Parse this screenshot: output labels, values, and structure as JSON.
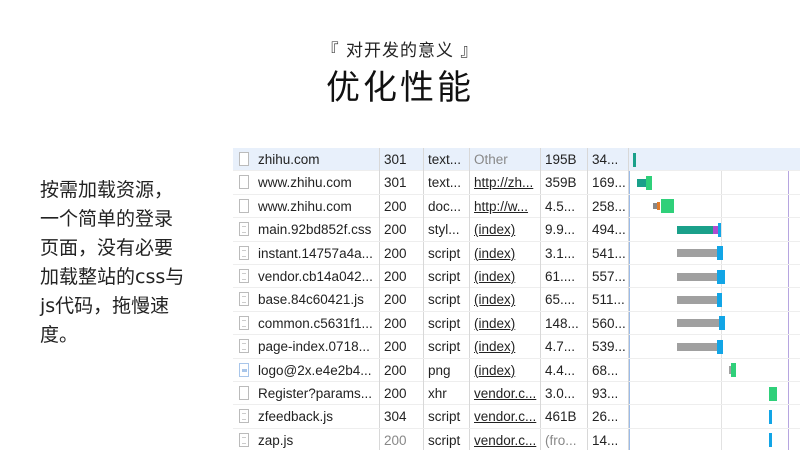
{
  "slide": {
    "subtitle": "『 对开发的意义 』",
    "title": "优化性能",
    "note_lines": [
      "按需加载资源，",
      "一个简单的登录",
      "页面，没有必要",
      "加载整站的css与",
      "js代码，拖慢速",
      "度。"
    ]
  },
  "colors": {
    "waiting": "#a0a0a0",
    "download": "#12a5e6",
    "teal": "#1aa08a",
    "green": "#2fd07a",
    "initial": "#888888"
  },
  "network": {
    "rows": [
      {
        "name": "zhihu.com",
        "status": "301",
        "type": "text...",
        "initiator": "Other",
        "size": "195B",
        "time": "34...",
        "icon": "document-icon"
      },
      {
        "name": "www.zhihu.com",
        "status": "301",
        "type": "text...",
        "initiator": "http://zh...",
        "size": "359B",
        "time": "169...",
        "icon": "document-icon"
      },
      {
        "name": "www.zhihu.com",
        "status": "200",
        "type": "doc...",
        "initiator": "http://w...",
        "size": "4.5...",
        "time": "258...",
        "icon": "document-icon"
      },
      {
        "name": "main.92bd852f.css",
        "status": "200",
        "type": "styl...",
        "initiator": "(index)",
        "size": "9.9...",
        "time": "494...",
        "icon": "stylesheet-icon"
      },
      {
        "name": "instant.14757a4a...",
        "status": "200",
        "type": "script",
        "initiator": "(index)",
        "size": "3.1...",
        "time": "541...",
        "icon": "script-icon"
      },
      {
        "name": "vendor.cb14a042...",
        "status": "200",
        "type": "script",
        "initiator": "(index)",
        "size": "61....",
        "time": "557...",
        "icon": "script-icon"
      },
      {
        "name": "base.84c60421.js",
        "status": "200",
        "type": "script",
        "initiator": "(index)",
        "size": "65....",
        "time": "511...",
        "icon": "script-icon"
      },
      {
        "name": "common.c5631f1...",
        "status": "200",
        "type": "script",
        "initiator": "(index)",
        "size": "148...",
        "time": "560...",
        "icon": "script-icon"
      },
      {
        "name": "page-index.0718...",
        "status": "200",
        "type": "script",
        "initiator": "(index)",
        "size": "4.7...",
        "time": "539...",
        "icon": "script-icon"
      },
      {
        "name": "logo@2x.e4e2b4...",
        "status": "200",
        "type": "png",
        "initiator": "(index)",
        "size": "4.4...",
        "time": "68...",
        "icon": "image-icon"
      },
      {
        "name": "Register?params...",
        "status": "200",
        "type": "xhr",
        "initiator": "vendor.c...",
        "size": "3.0...",
        "time": "93...",
        "icon": "document-icon"
      },
      {
        "name": "zfeedback.js",
        "status": "304",
        "type": "script",
        "initiator": "vendor.c...",
        "size": "461B",
        "time": "26...",
        "icon": "script-icon"
      },
      {
        "name": "zap.js",
        "status": "200",
        "type": "script",
        "initiator": "vendor.c...",
        "size": "(fro...",
        "time": "14...",
        "icon": "script-icon"
      }
    ]
  }
}
